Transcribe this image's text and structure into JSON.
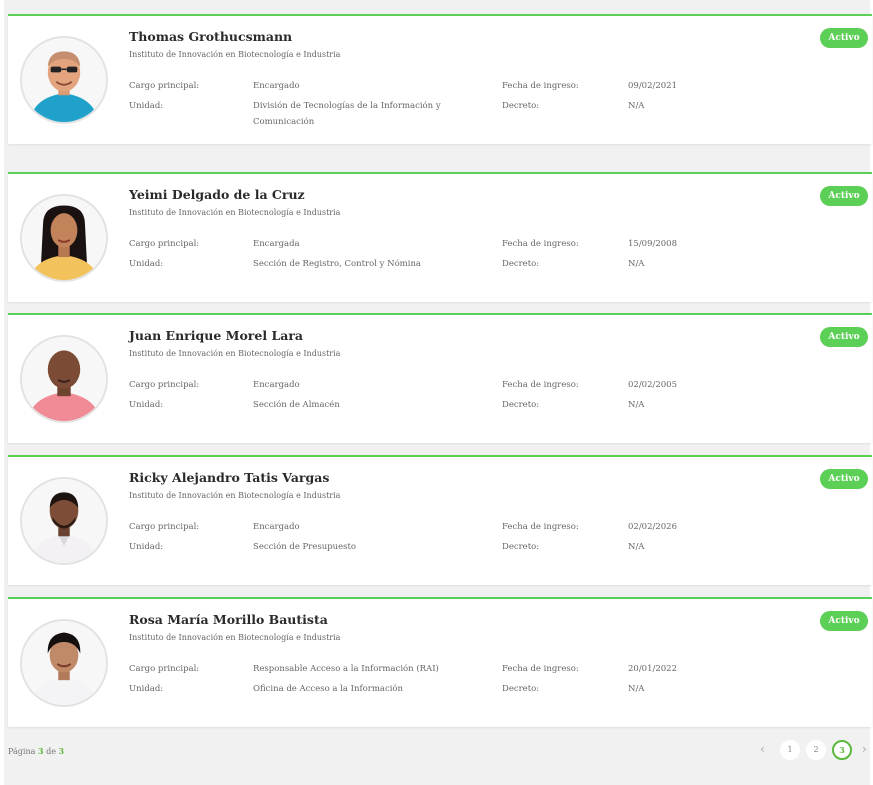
{
  "status_label": "Activo",
  "labels": {
    "cargo": "Cargo principal:",
    "unidad": "Unidad:",
    "fecha": "Fecha de ingreso:",
    "decreto": "Decreto:"
  },
  "people": [
    {
      "name": "Thomas Grothucsmann",
      "institution": "Instituto de Innovación en Biotecnología e Industria",
      "cargo": "Encargado",
      "unidad": "División de Tecnologías de la Información y Comunicación",
      "fecha": "09/02/2021",
      "decreto": "N/A"
    },
    {
      "name": "Yeimi Delgado de la Cruz",
      "institution": "Instituto de Innovación en Biotecnología e Industria",
      "cargo": "Encargada",
      "unidad": "Sección de Registro, Control y Nómina",
      "fecha": "15/09/2008",
      "decreto": "N/A"
    },
    {
      "name": "Juan Enrique Morel Lara",
      "institution": "Instituto de Innovación en Biotecnología e Industria",
      "cargo": "Encargado",
      "unidad": "Sección de Almacén",
      "fecha": "02/02/2005",
      "decreto": "N/A"
    },
    {
      "name": "Ricky Alejandro Tatis Vargas",
      "institution": "Instituto de Innovación en Biotecnología e Industria",
      "cargo": "Encargado",
      "unidad": "Sección de Presupuesto",
      "fecha": "02/02/2026",
      "decreto": "N/A"
    },
    {
      "name": "Rosa María Morillo Bautista",
      "institution": "Instituto de Innovación en Biotecnología e Industria",
      "cargo": "Responsable Acceso a la Información (RAI)",
      "unidad": "Oficina de Acceso a la Información",
      "fecha": "20/01/2022",
      "decreto": "N/A"
    }
  ],
  "pagination": {
    "page_word": "Página",
    "of_word": "de",
    "current": "3",
    "total": "3",
    "pages": [
      "1",
      "2",
      "3"
    ],
    "prev_icon": "chevron-left-icon",
    "next_icon": "chevron-right-icon"
  },
  "colors": {
    "accent": "#5ccf56",
    "accent_dark": "#5cb83c",
    "background": "#f1f1f1"
  }
}
